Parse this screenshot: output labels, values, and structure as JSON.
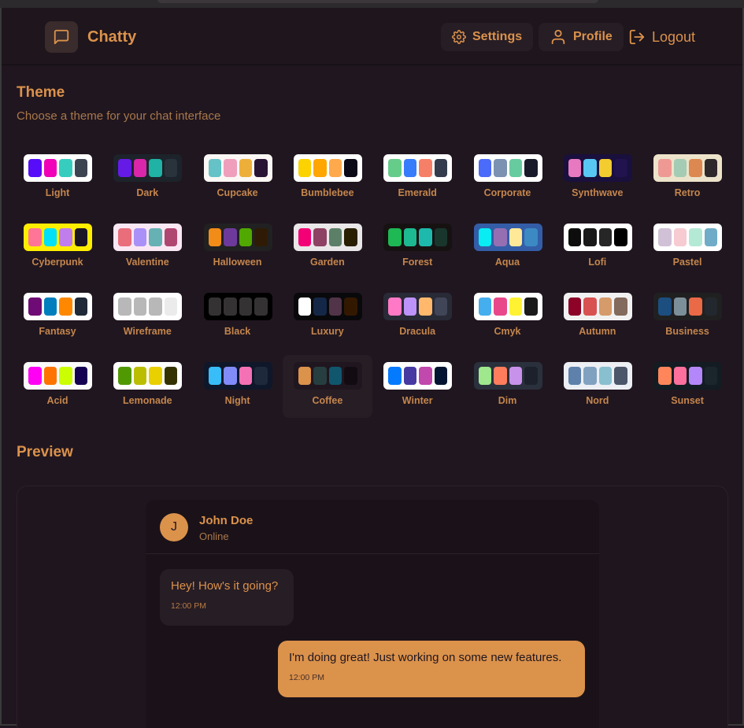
{
  "app": {
    "name": "Chatty"
  },
  "nav": {
    "settings": "Settings",
    "profile": "Profile",
    "logout": "Logout"
  },
  "theme_section": {
    "title": "Theme",
    "subtitle": "Choose a theme for your chat interface",
    "selected": "Coffee",
    "themes": [
      {
        "name": "Light",
        "colors": [
          "#570df8",
          "#f000b8",
          "#37cdbe",
          "#3d4451"
        ],
        "bg": "#ffffff"
      },
      {
        "name": "Dark",
        "colors": [
          "#661ae6",
          "#d926aa",
          "#1fb2a5",
          "#2a323c"
        ],
        "bg": "#1d232a"
      },
      {
        "name": "Cupcake",
        "colors": [
          "#65c3c8",
          "#ef9fbc",
          "#eeaf3a",
          "#291334"
        ],
        "bg": "#faf7f5"
      },
      {
        "name": "Bumblebee",
        "colors": [
          "#fcd300",
          "#ffa600",
          "#ffa94d",
          "#0b0b18"
        ],
        "bg": "#ffffff"
      },
      {
        "name": "Emerald",
        "colors": [
          "#66cc8a",
          "#377cfb",
          "#f68067",
          "#333c4d"
        ],
        "bg": "#ffffff"
      },
      {
        "name": "Corporate",
        "colors": [
          "#4b6bfb",
          "#7b92b2",
          "#67cba0",
          "#181a2a"
        ],
        "bg": "#ffffff"
      },
      {
        "name": "Synthwave",
        "colors": [
          "#e779c1",
          "#58c7f3",
          "#f3cc30",
          "#20134e"
        ],
        "bg": "#1a103d"
      },
      {
        "name": "Retro",
        "colors": [
          "#ef9995",
          "#a4cbb4",
          "#dc8850",
          "#2e282a"
        ],
        "bg": "#ece3ca"
      },
      {
        "name": "Cyberpunk",
        "colors": [
          "#ff7598",
          "#00e0f8",
          "#c07eec",
          "#1b1626"
        ],
        "bg": "#ffee00"
      },
      {
        "name": "Valentine",
        "colors": [
          "#e96d7b",
          "#a991f7",
          "#66b1b3",
          "#af4670"
        ],
        "bg": "#fae7f4"
      },
      {
        "name": "Halloween",
        "colors": [
          "#f28c18",
          "#6d3a9c",
          "#51a800",
          "#2f1b05"
        ],
        "bg": "#212121"
      },
      {
        "name": "Garden",
        "colors": [
          "#f40076",
          "#8e4162",
          "#5c7f67",
          "#291e00"
        ],
        "bg": "#e9e7e7"
      },
      {
        "name": "Forest",
        "colors": [
          "#1eb854",
          "#1db990",
          "#1db9ac",
          "#19362d"
        ],
        "bg": "#171212"
      },
      {
        "name": "Aqua",
        "colors": [
          "#09ecf3",
          "#966fb3",
          "#ffe999",
          "#3b8ac4"
        ],
        "bg": "#345da7"
      },
      {
        "name": "Lofi",
        "colors": [
          "#0d0d0d",
          "#1a1919",
          "#262626",
          "#000000"
        ],
        "bg": "#ffffff"
      },
      {
        "name": "Pastel",
        "colors": [
          "#d1c1d7",
          "#f6cbd1",
          "#b4e9d6",
          "#70acc7"
        ],
        "bg": "#ffffff"
      },
      {
        "name": "Fantasy",
        "colors": [
          "#6e0b75",
          "#007ebd",
          "#ff8800",
          "#1f2937"
        ],
        "bg": "#ffffff"
      },
      {
        "name": "Wireframe",
        "colors": [
          "#b8b8b8",
          "#b8b8b8",
          "#b8b8b8",
          "#ebebeb"
        ],
        "bg": "#ffffff"
      },
      {
        "name": "Black",
        "colors": [
          "#343232",
          "#343232",
          "#343232",
          "#343232"
        ],
        "bg": "#000000"
      },
      {
        "name": "Luxury",
        "colors": [
          "#ffffff",
          "#152747",
          "#513448",
          "#331800"
        ],
        "bg": "#09090b"
      },
      {
        "name": "Dracula",
        "colors": [
          "#ff79c6",
          "#bd93f9",
          "#ffb86c",
          "#414558"
        ],
        "bg": "#282a36"
      },
      {
        "name": "Cmyk",
        "colors": [
          "#45aeee",
          "#e8488a",
          "#fff232",
          "#1a1a1a"
        ],
        "bg": "#ffffff"
      },
      {
        "name": "Autumn",
        "colors": [
          "#8c0327",
          "#d85251",
          "#d59b6a",
          "#826a5c"
        ],
        "bg": "#f1f1f1"
      },
      {
        "name": "Business",
        "colors": [
          "#1c4e80",
          "#7c909a",
          "#ea6947",
          "#23282e"
        ],
        "bg": "#202020"
      },
      {
        "name": "Acid",
        "colors": [
          "#ff00f4",
          "#ff7400",
          "#cbfd03",
          "#140152"
        ],
        "bg": "#fafafa"
      },
      {
        "name": "Lemonade",
        "colors": [
          "#519903",
          "#bbbe00",
          "#e9d000",
          "#343300"
        ],
        "bg": "#ffffff"
      },
      {
        "name": "Night",
        "colors": [
          "#38bdf8",
          "#818cf8",
          "#f471b5",
          "#1e293b"
        ],
        "bg": "#0f172a"
      },
      {
        "name": "Coffee",
        "colors": [
          "#db924b",
          "#263e3f",
          "#10576d",
          "#120c12"
        ],
        "bg": "#20161f"
      },
      {
        "name": "Winter",
        "colors": [
          "#047aff",
          "#463aa2",
          "#c148ac",
          "#021431"
        ],
        "bg": "#ffffff"
      },
      {
        "name": "Dim",
        "colors": [
          "#9fe88d",
          "#ff7d5c",
          "#c792e9",
          "#1c212b"
        ],
        "bg": "#2a303c"
      },
      {
        "name": "Nord",
        "colors": [
          "#5e81ac",
          "#81a1c1",
          "#88c0d0",
          "#4c566a"
        ],
        "bg": "#eceff4"
      },
      {
        "name": "Sunset",
        "colors": [
          "#ff865b",
          "#fd6f9c",
          "#b387fa",
          "#1b262c"
        ],
        "bg": "#121c22"
      }
    ]
  },
  "preview": {
    "title": "Preview",
    "contact": {
      "initial": "J",
      "name": "John Doe",
      "status": "Online"
    },
    "messages": [
      {
        "text": "Hey! How's it going?",
        "time": "12:00 PM",
        "sent": false
      },
      {
        "text": "I'm doing great! Just working on some new features.",
        "time": "12:00 PM",
        "sent": true
      }
    ]
  }
}
